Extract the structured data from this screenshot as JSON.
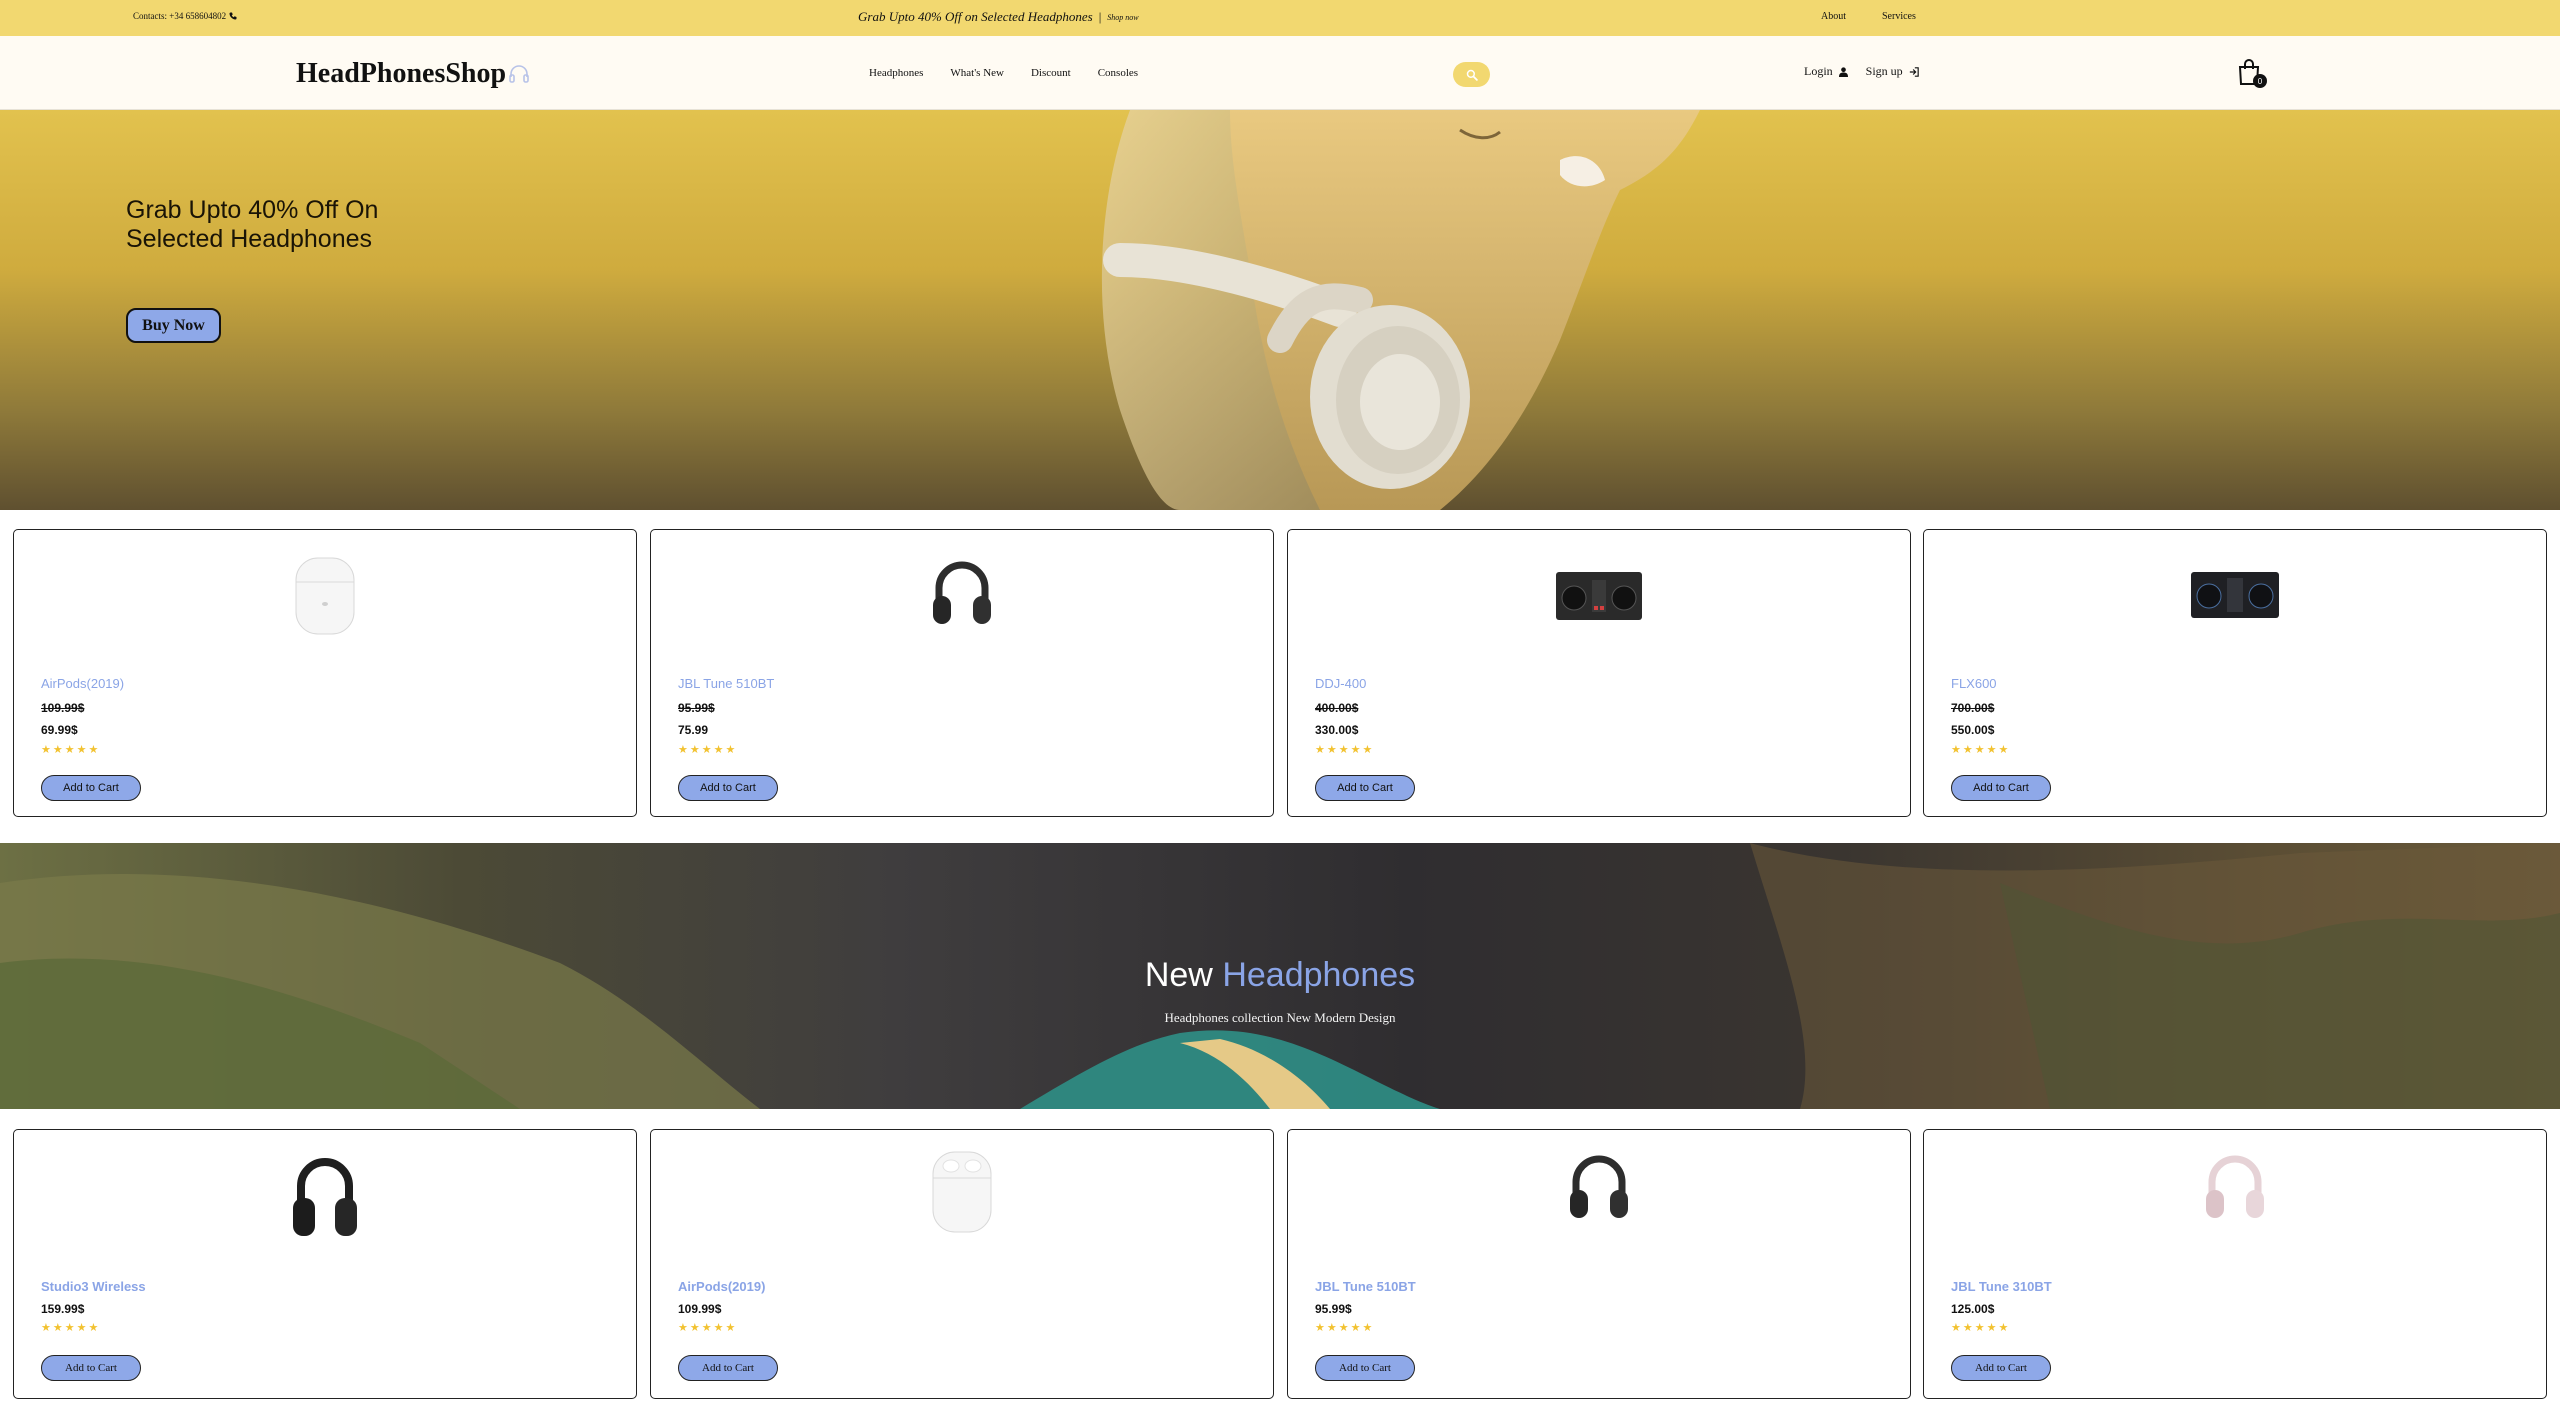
{
  "topbar": {
    "contact": "Contacts: +34 658604802",
    "promo": "Grab Upto 40% Off on Selected Headphones",
    "separator": "|",
    "shop_now": "Shop now",
    "about": "About",
    "services": "Services"
  },
  "header": {
    "logo": "HeadPhonesShop",
    "nav": [
      "Headphones",
      "What's New",
      "Discount",
      "Consoles"
    ],
    "login": "Login",
    "signup": "Sign up",
    "cart_count": "0"
  },
  "hero": {
    "title": "Grab Upto 40% Off On Selected Headphones",
    "button": "Buy Now"
  },
  "featured": [
    {
      "name": "AirPods(2019)",
      "old_price": "109.99$",
      "price": "69.99$",
      "rating": 5,
      "button": "Add to Cart",
      "image": "airpods"
    },
    {
      "name": "JBL Tune 510BT",
      "old_price": "95.99$",
      "price": "75.99",
      "rating": 5,
      "button": "Add to Cart",
      "image": "headphones-black"
    },
    {
      "name": "DDJ-400",
      "old_price": "400.00$",
      "price": "330.00$",
      "rating": 5,
      "button": "Add to Cart",
      "image": "dj-controller"
    },
    {
      "name": "FLX600",
      "old_price": "700.00$",
      "price": "550.00$",
      "rating": 5,
      "button": "Add to Cart",
      "image": "dj-controller"
    }
  ],
  "banner": {
    "title_main": "New",
    "title_accent": "Headphones",
    "subtitle": "Headphones collection New Modern Design"
  },
  "new_products": [
    {
      "name": "Studio3 Wireless",
      "price": "159.99$",
      "rating": 5,
      "button": "Add to Cart",
      "image": "headphones-black-large"
    },
    {
      "name": "AirPods(2019)",
      "price": "109.99$",
      "rating": 5,
      "button": "Add to Cart",
      "image": "airpods"
    },
    {
      "name": "JBL Tune 510BT",
      "price": "95.99$",
      "rating": 5,
      "button": "Add to Cart",
      "image": "headphones-black"
    },
    {
      "name": "JBL Tune 310BT",
      "price": "125.00$",
      "rating": 5,
      "button": "Add to Cart",
      "image": "headphones-pink"
    }
  ],
  "colors": {
    "topbar": "#f2d870",
    "accent_blue": "#8aa4e6",
    "button_blue": "#8ea8e8",
    "star": "#f2c230"
  }
}
